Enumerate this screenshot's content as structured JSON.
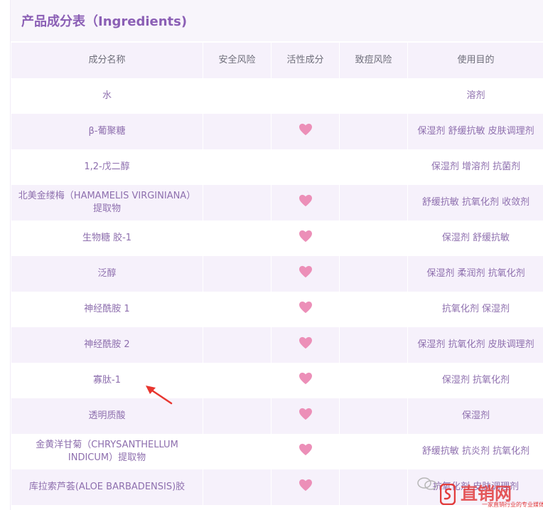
{
  "section": {
    "title": "产品成分表（Ingredients)"
  },
  "table": {
    "headers": [
      "成分名称",
      "安全风险",
      "活性成分",
      "致痘风险",
      "使用目的"
    ],
    "rows": [
      {
        "name": "水",
        "safety": "",
        "active": false,
        "acne": "",
        "purpose": "溶剂"
      },
      {
        "name": "β-葡聚糖",
        "safety": "",
        "active": true,
        "acne": "",
        "purpose": "保湿剂 舒缓抗敏 皮肤调理剂"
      },
      {
        "name": "1,2-戊二醇",
        "safety": "",
        "active": false,
        "acne": "",
        "purpose": "保湿剂 增溶剂 抗菌剂"
      },
      {
        "name": "北美金缕梅（HAMAMELIS VIRGINIANA）提取物",
        "safety": "",
        "active": true,
        "acne": "",
        "purpose": "舒缓抗敏 抗氧化剂 收敛剂"
      },
      {
        "name": "生物糖 胶-1",
        "safety": "",
        "active": true,
        "acne": "",
        "purpose": "保湿剂 舒缓抗敏"
      },
      {
        "name": "泛醇",
        "safety": "",
        "active": true,
        "acne": "",
        "purpose": "保湿剂 柔润剂 抗氧化剂"
      },
      {
        "name": "神经酰胺 1",
        "safety": "",
        "active": true,
        "acne": "",
        "purpose": "抗氧化剂 保湿剂"
      },
      {
        "name": "神经酰胺 2",
        "safety": "",
        "active": true,
        "acne": "",
        "purpose": "保湿剂 抗氧化剂 皮肤调理剂"
      },
      {
        "name": "寡肽-1",
        "safety": "",
        "active": true,
        "acne": "",
        "purpose": "保湿剂 抗氧化剂"
      },
      {
        "name": "透明质酸",
        "safety": "",
        "active": true,
        "acne": "",
        "purpose": "保湿剂"
      },
      {
        "name": "金黄洋甘菊（CHRYSANTHELLUM INDICUM）提取物",
        "safety": "",
        "active": true,
        "acne": "",
        "purpose": "舒缓抗敏 抗炎剂 抗氧化剂"
      },
      {
        "name": "库拉索芦荟(ALOE BARBADENSIS)胶",
        "safety": "",
        "active": true,
        "acne": "",
        "purpose": "抗氧化剂 皮肤调理剂"
      }
    ]
  },
  "colors": {
    "title": "#8b5fb5",
    "heart": "#ec8fb8",
    "header_bg": "#f6f1fb",
    "arrow": "#e8362f",
    "watermark": "#e23c3c"
  },
  "icons": {
    "active_marker": "heart-icon",
    "annotation": "red-arrow-icon",
    "watermark_logo": "s-logo-icon"
  },
  "watermark": {
    "name": "直销网",
    "tagline": "一家直销行业的专业媒体"
  }
}
